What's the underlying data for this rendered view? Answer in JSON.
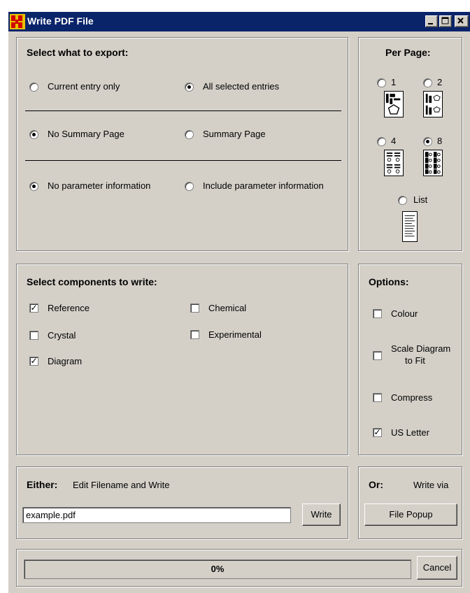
{
  "window": {
    "title": "Write PDF File"
  },
  "export": {
    "heading": "Select what to export:",
    "current_entry": "Current entry only",
    "all_selected": "All selected entries",
    "no_summary": "No Summary Page",
    "summary": "Summary Page",
    "no_param": "No parameter information",
    "include_param": "Include parameter information",
    "selected": {
      "entries": "All selected entries",
      "summary": "No Summary Page",
      "params": "No parameter information"
    }
  },
  "per_page": {
    "heading": "Per Page:",
    "opt1": "1",
    "opt2": "2",
    "opt4": "4",
    "opt8": "8",
    "list": "List",
    "selected": "8"
  },
  "components": {
    "heading": "Select components to write:",
    "reference": "Reference",
    "chemical": "Chemical",
    "crystal": "Crystal",
    "experimental": "Experimental",
    "diagram": "Diagram",
    "checked": {
      "reference": true,
      "chemical": false,
      "crystal": false,
      "experimental": false,
      "diagram": true
    }
  },
  "options": {
    "heading": "Options:",
    "colour": "Colour",
    "scale_line1": "Scale Diagram",
    "scale_line2": "to Fit",
    "compress": "Compress",
    "us_letter": "US Letter",
    "checked": {
      "colour": false,
      "scale": false,
      "compress": false,
      "us_letter": true
    }
  },
  "either": {
    "heading": "Either:",
    "subtitle": "Edit Filename and Write",
    "filename": "example.pdf",
    "write_label": "Write"
  },
  "or": {
    "heading": "Or:",
    "subtitle": "Write via",
    "file_popup_label": "File Popup"
  },
  "progress": {
    "text": "0%",
    "value": 0,
    "cancel_label": "Cancel"
  },
  "colors": {
    "titlebar": "#0a246a",
    "face": "#d4d0c8"
  }
}
